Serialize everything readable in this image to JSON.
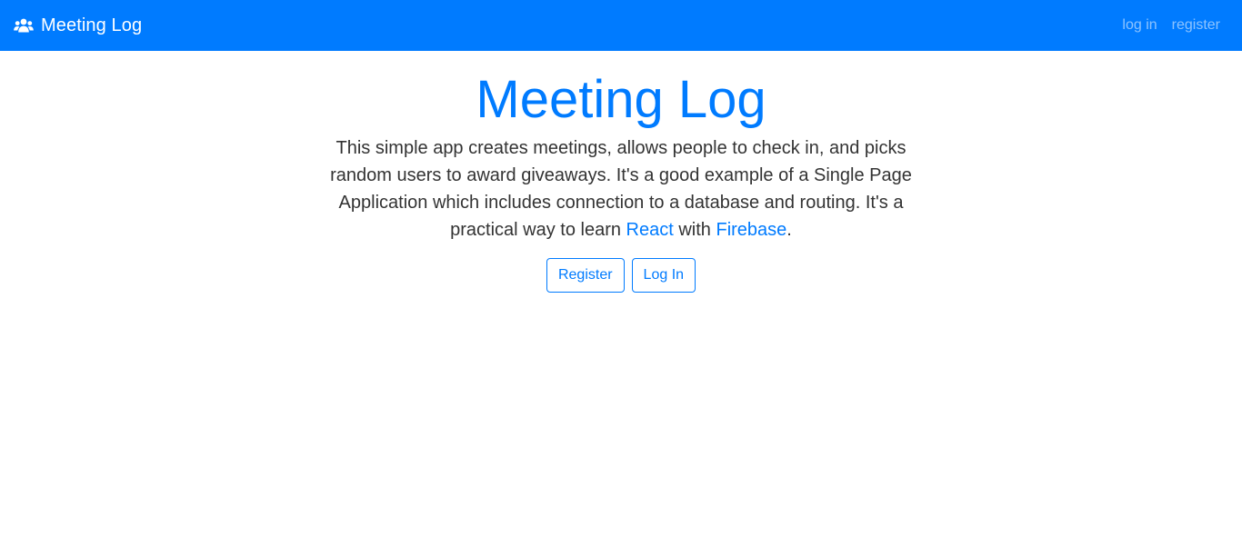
{
  "navbar": {
    "brand_icon": "users-icon",
    "brand_text": "Meeting Log",
    "links": [
      "log in",
      "register"
    ],
    "background_color": "#007bff"
  },
  "hero": {
    "title": "Meeting Log",
    "description_parts": {
      "intro": "This simple app creates meetings, allows people to check in, and picks random users to award giveaways. It's a good example of a Single Page Application which includes connection to a database and routing. It's a practical way to learn ",
      "link_react": "React",
      "with": " with ",
      "link_firebase": "Firebase",
      "end": "."
    },
    "buttons": {
      "register": "Register",
      "login": "Log In"
    },
    "accent_color": "#007bff"
  }
}
